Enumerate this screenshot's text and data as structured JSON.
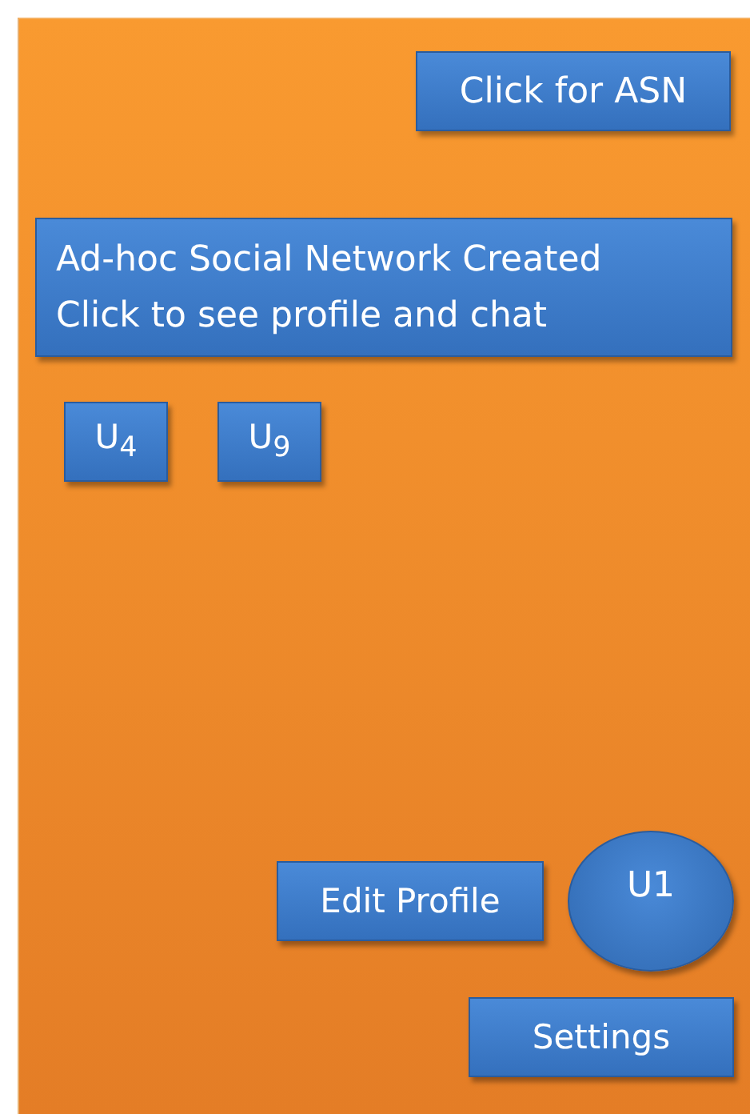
{
  "asn_button": "Click for ASN",
  "network_banner": {
    "lines": [
      "Ad-hoc Social Network Created",
      "Click to see profile and chat"
    ]
  },
  "users": [
    "U$_{4}$",
    "U$_{9}$"
  ],
  "edit_profile_button": "Edit Profile",
  "avatar": "U1",
  "settings_button": "Settings"
}
